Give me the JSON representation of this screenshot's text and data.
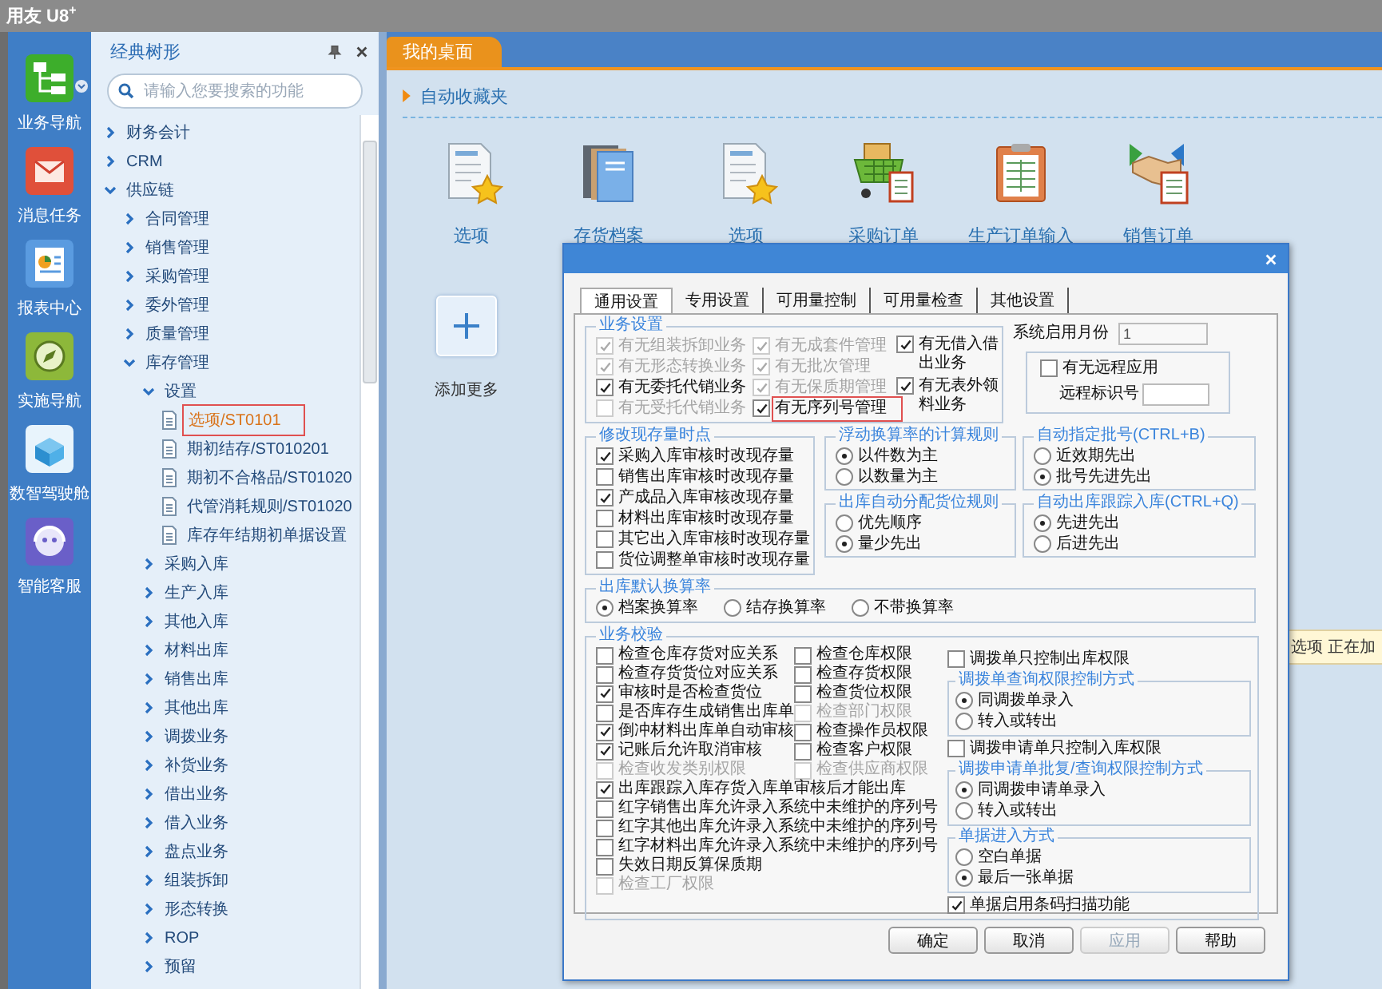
{
  "app": {
    "title": "用友 U8$^{+}$"
  },
  "nav_rail": [
    {
      "label": "业务导航",
      "kind": "tree"
    },
    {
      "label": "消息任务",
      "kind": "mail"
    },
    {
      "label": "报表中心",
      "kind": "report"
    },
    {
      "label": "实施导航",
      "kind": "compass"
    },
    {
      "label": "数智驾驶舱",
      "kind": "cube"
    },
    {
      "label": "智能客服",
      "kind": "headset"
    }
  ],
  "sidebar": {
    "title": "经典树形",
    "search": {
      "placeholder": "请输入您要搜索的功能"
    },
    "tree": [
      {
        "label": "财务会计",
        "kind": "folder",
        "expanded": false
      },
      {
        "label": "CRM",
        "kind": "folder",
        "expanded": false
      },
      {
        "label": "供应链",
        "kind": "folder",
        "expanded": true,
        "children": [
          {
            "label": "合同管理",
            "kind": "folder",
            "expanded": false
          },
          {
            "label": "销售管理",
            "kind": "folder",
            "expanded": false
          },
          {
            "label": "采购管理",
            "kind": "folder",
            "expanded": false
          },
          {
            "label": "委外管理",
            "kind": "folder",
            "expanded": false
          },
          {
            "label": "质量管理",
            "kind": "folder",
            "expanded": false
          },
          {
            "label": "库存管理",
            "kind": "folder",
            "expanded": true,
            "children": [
              {
                "label": "设置",
                "kind": "folder",
                "expanded": true,
                "children": [
                  {
                    "label": "选项/ST0101",
                    "kind": "doc",
                    "selected": true
                  },
                  {
                    "label": "期初结存/ST010201",
                    "kind": "doc",
                    "selected": false
                  },
                  {
                    "label": "期初不合格品/ST01020",
                    "kind": "doc",
                    "selected": false
                  },
                  {
                    "label": "代管消耗规则/ST01020",
                    "kind": "doc",
                    "selected": false
                  },
                  {
                    "label": "库存年结期初单据设置",
                    "kind": "doc",
                    "selected": false
                  }
                ]
              },
              {
                "label": "采购入库",
                "kind": "folder",
                "expanded": false
              },
              {
                "label": "生产入库",
                "kind": "folder",
                "expanded": false
              },
              {
                "label": "其他入库",
                "kind": "folder",
                "expanded": false
              },
              {
                "label": "材料出库",
                "kind": "folder",
                "expanded": false
              },
              {
                "label": "销售出库",
                "kind": "folder",
                "expanded": false
              },
              {
                "label": "其他出库",
                "kind": "folder",
                "expanded": false
              },
              {
                "label": "调拨业务",
                "kind": "folder",
                "expanded": false
              },
              {
                "label": "补货业务",
                "kind": "folder",
                "expanded": false
              },
              {
                "label": "借出业务",
                "kind": "folder",
                "expanded": false
              },
              {
                "label": "借入业务",
                "kind": "folder",
                "expanded": false
              },
              {
                "label": "盘点业务",
                "kind": "folder",
                "expanded": false
              },
              {
                "label": "组装拆卸",
                "kind": "folder",
                "expanded": false
              },
              {
                "label": "形态转换",
                "kind": "folder",
                "expanded": false
              },
              {
                "label": "ROP",
                "kind": "folder",
                "expanded": false
              },
              {
                "label": "预留",
                "kind": "folder",
                "expanded": false
              }
            ]
          }
        ]
      }
    ]
  },
  "tabs": [
    {
      "label": "我的桌面",
      "selected": true
    }
  ],
  "favorites": {
    "title": "自动收藏夹",
    "shortcuts": [
      {
        "label": "选项",
        "kind": "doc-star"
      },
      {
        "label": "存货档案",
        "kind": "books"
      },
      {
        "label": "选项",
        "kind": "doc-star"
      },
      {
        "label": "采购订单",
        "kind": "cart"
      },
      {
        "label": "生产订单输入",
        "kind": "clipboard"
      },
      {
        "label": "销售订单",
        "kind": "handshake"
      }
    ],
    "add_label": "添加更多"
  },
  "tooltip": "选项 正在加",
  "dialog": {
    "tabs": [
      {
        "label": "通用设置",
        "selected": true
      },
      {
        "label": "专用设置",
        "selected": false
      },
      {
        "label": "可用量控制",
        "selected": false
      },
      {
        "label": "可用量检查",
        "selected": false
      },
      {
        "label": "其他设置",
        "selected": false
      }
    ],
    "business": {
      "title": "业务设置",
      "columns": [
        [
          {
            "label": "有无组装拆卸业务",
            "checked": true,
            "disabled": true,
            "highlighted": false
          },
          {
            "label": "有无形态转换业务",
            "checked": true,
            "disabled": true,
            "highlighted": false
          },
          {
            "label": "有无委托代销业务",
            "checked": true,
            "disabled": false,
            "highlighted": false
          },
          {
            "label": "有无受托代销业务",
            "checked": false,
            "disabled": true,
            "highlighted": false
          }
        ],
        [
          {
            "label": "有无成套件管理",
            "checked": true,
            "disabled": true,
            "highlighted": false
          },
          {
            "label": "有无批次管理",
            "checked": true,
            "disabled": true,
            "highlighted": false
          },
          {
            "label": "有无保质期管理",
            "checked": true,
            "disabled": true,
            "highlighted": false
          },
          {
            "label": "有无序列号管理",
            "checked": true,
            "disabled": false,
            "highlighted": true
          }
        ],
        [
          {
            "label": "有无借入借出业务",
            "checked": true,
            "disabled": false,
            "highlighted": false
          },
          {
            "label": "有无表外领料业务",
            "checked": true,
            "disabled": false,
            "highlighted": false
          }
        ]
      ]
    },
    "start_month": {
      "label": "系统启用月份",
      "value": "1"
    },
    "remote": {
      "label": "有无远程应用",
      "checked": false,
      "id_label": "远程标识号"
    },
    "stock_update": {
      "title": "修改现存量时点",
      "items": [
        {
          "label": "采购入库审核时改现存量",
          "checked": true
        },
        {
          "label": "销售出库审核时改现存量",
          "checked": false
        },
        {
          "label": "产成品入库审核改现存量",
          "checked": true
        },
        {
          "label": "材料出库审核时改现存量",
          "checked": false
        },
        {
          "label": "其它出入库审核时改现存量",
          "checked": false
        },
        {
          "label": "货位调整单审核时改现存量",
          "checked": false
        }
      ]
    },
    "rules": [
      {
        "title": "浮动换算率的计算规则",
        "options": [
          {
            "label": "以件数为主",
            "selected": true
          },
          {
            "label": "以数量为主",
            "selected": false
          }
        ]
      },
      {
        "title": "出库自动分配货位规则",
        "options": [
          {
            "label": "优先顺序",
            "selected": false
          },
          {
            "label": "量少先出",
            "selected": true
          }
        ]
      },
      {
        "title": "自动指定批号(CTRL+B)",
        "options": [
          {
            "label": "近效期先出",
            "selected": false
          },
          {
            "label": "批号先进先出",
            "selected": true
          }
        ]
      },
      {
        "title": "自动出库跟踪入库(CTRL+Q)",
        "options": [
          {
            "label": "先进先出",
            "selected": true
          },
          {
            "label": "后进先出",
            "selected": false
          }
        ]
      }
    ],
    "conversion": {
      "title": "出库默认换算率",
      "options": [
        {
          "label": "档案换算率",
          "selected": true
        },
        {
          "label": "结存换算率",
          "selected": false
        },
        {
          "label": "不带换算率",
          "selected": false
        }
      ]
    },
    "checks": {
      "title": "业务校验",
      "grid": [
        {
          "label": "检查仓库存货对应关系",
          "checked": false,
          "disabled": false
        },
        {
          "label": "检查仓库权限",
          "checked": false,
          "disabled": false
        },
        {
          "label": "检查存货货位对应关系",
          "checked": false,
          "disabled": false
        },
        {
          "label": "检查存货权限",
          "checked": false,
          "disabled": false
        },
        {
          "label": "审核时是否检查货位",
          "checked": true,
          "disabled": false
        },
        {
          "label": "检查货位权限",
          "checked": false,
          "disabled": false
        },
        {
          "label": "是否库存生成销售出库单",
          "checked": false,
          "disabled": false
        },
        {
          "label": "检查部门权限",
          "checked": false,
          "disabled": true
        },
        {
          "label": "倒冲材料出库单自动审核",
          "checked": true,
          "disabled": false
        },
        {
          "label": "检查操作员权限",
          "checked": false,
          "disabled": false
        },
        {
          "label": "记账后允许取消审核",
          "checked": true,
          "disabled": false
        },
        {
          "label": "检查客户权限",
          "checked": false,
          "disabled": false
        },
        {
          "label": "检查收发类别权限",
          "checked": false,
          "disabled": true
        },
        {
          "label": "检查供应商权限",
          "checked": false,
          "disabled": true
        }
      ],
      "rows": [
        {
          "label": "出库跟踪入库存货入库单审核后才能出库",
          "checked": true,
          "disabled": false
        },
        {
          "label": "红字销售出库允许录入系统中未维护的序列号",
          "checked": false,
          "disabled": false
        },
        {
          "label": "红字其他出库允许录入系统中未维护的序列号",
          "checked": false,
          "disabled": false
        },
        {
          "label": "红字材料出库允许录入系统中未维护的序列号",
          "checked": false,
          "disabled": false
        },
        {
          "label": "失效日期反算保质期",
          "checked": false,
          "disabled": false
        },
        {
          "label": "检查工厂权限",
          "checked": false,
          "disabled": true
        }
      ],
      "transfer_out_only": {
        "label": "调拨单只控制出库权限",
        "checked": false
      },
      "transfer_query": {
        "title": "调拨单查询权限控制方式",
        "options": [
          {
            "label": "同调拨单录入",
            "selected": true
          },
          {
            "label": "转入或转出",
            "selected": false
          }
        ]
      },
      "request_in_only": {
        "label": "调拨申请单只控制入库权限",
        "checked": false
      },
      "request_query": {
        "title": "调拨申请单批复/查询权限控制方式",
        "options": [
          {
            "label": "同调拨申请单录入",
            "selected": true
          },
          {
            "label": "转入或转出",
            "selected": false
          }
        ]
      },
      "entry_mode": {
        "title": "单据进入方式",
        "options": [
          {
            "label": "空白单据",
            "selected": false
          },
          {
            "label": "最后一张单据",
            "selected": true
          }
        ]
      },
      "barcode": {
        "label": "单据启用条码扫描功能",
        "checked": true
      }
    },
    "buttons": [
      {
        "label": "确定",
        "disabled": false
      },
      {
        "label": "取消",
        "disabled": false
      },
      {
        "label": "应用",
        "disabled": true
      },
      {
        "label": "帮助",
        "disabled": false
      }
    ]
  }
}
